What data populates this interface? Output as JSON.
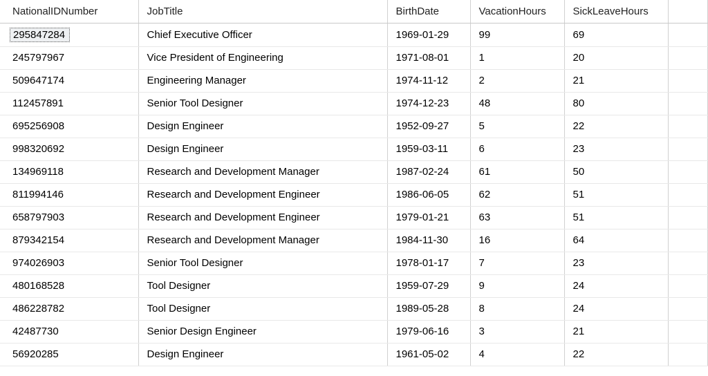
{
  "columns": {
    "national_id": "NationalIDNumber",
    "job_title": "JobTitle",
    "birth_date": "BirthDate",
    "vacation_hours": "VacationHours",
    "sick_leave_hours": "SickLeaveHours"
  },
  "rows": [
    {
      "national_id": "295847284",
      "job_title": "Chief Executive Officer",
      "birth_date": "1969-01-29",
      "vacation_hours": "99",
      "sick_leave_hours": "69",
      "selected": true
    },
    {
      "national_id": "245797967",
      "job_title": "Vice President of Engineering",
      "birth_date": "1971-08-01",
      "vacation_hours": "1",
      "sick_leave_hours": "20"
    },
    {
      "national_id": "509647174",
      "job_title": "Engineering Manager",
      "birth_date": "1974-11-12",
      "vacation_hours": "2",
      "sick_leave_hours": "21"
    },
    {
      "national_id": "112457891",
      "job_title": "Senior Tool Designer",
      "birth_date": "1974-12-23",
      "vacation_hours": "48",
      "sick_leave_hours": "80"
    },
    {
      "national_id": "695256908",
      "job_title": "Design Engineer",
      "birth_date": "1952-09-27",
      "vacation_hours": "5",
      "sick_leave_hours": "22"
    },
    {
      "national_id": "998320692",
      "job_title": "Design Engineer",
      "birth_date": "1959-03-11",
      "vacation_hours": "6",
      "sick_leave_hours": "23"
    },
    {
      "national_id": "134969118",
      "job_title": "Research and Development Manager",
      "birth_date": "1987-02-24",
      "vacation_hours": "61",
      "sick_leave_hours": "50"
    },
    {
      "national_id": "811994146",
      "job_title": "Research and Development Engineer",
      "birth_date": "1986-06-05",
      "vacation_hours": "62",
      "sick_leave_hours": "51"
    },
    {
      "national_id": "658797903",
      "job_title": "Research and Development Engineer",
      "birth_date": "1979-01-21",
      "vacation_hours": "63",
      "sick_leave_hours": "51"
    },
    {
      "national_id": "879342154",
      "job_title": "Research and Development Manager",
      "birth_date": "1984-11-30",
      "vacation_hours": "16",
      "sick_leave_hours": "64"
    },
    {
      "national_id": "974026903",
      "job_title": "Senior Tool Designer",
      "birth_date": "1978-01-17",
      "vacation_hours": "7",
      "sick_leave_hours": "23"
    },
    {
      "national_id": "480168528",
      "job_title": "Tool Designer",
      "birth_date": "1959-07-29",
      "vacation_hours": "9",
      "sick_leave_hours": "24"
    },
    {
      "national_id": "486228782",
      "job_title": "Tool Designer",
      "birth_date": "1989-05-28",
      "vacation_hours": "8",
      "sick_leave_hours": "24"
    },
    {
      "national_id": "42487730",
      "job_title": "Senior Design Engineer",
      "birth_date": "1979-06-16",
      "vacation_hours": "3",
      "sick_leave_hours": "21"
    },
    {
      "national_id": "56920285",
      "job_title": "Design Engineer",
      "birth_date": "1961-05-02",
      "vacation_hours": "4",
      "sick_leave_hours": "22"
    }
  ]
}
